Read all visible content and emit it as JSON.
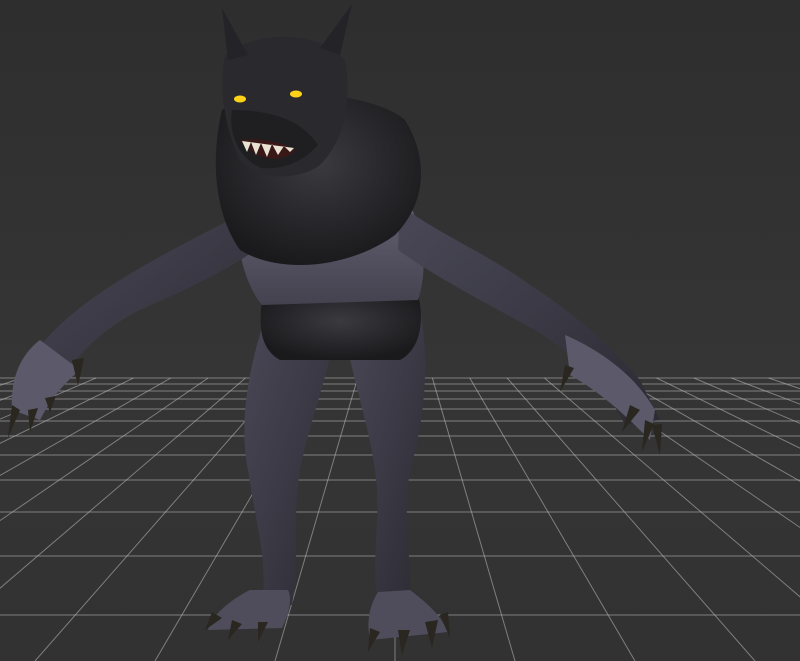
{
  "viewport": {
    "background_color": "#333333",
    "grid_color": "#bdbdbd",
    "grid_visible": true
  },
  "model": {
    "fur_color": "#262629",
    "skin_color": "#5a5868",
    "eye_color": "#ffd21a",
    "claw_color": "#2a2620",
    "teeth_color": "#e8e3d2"
  }
}
